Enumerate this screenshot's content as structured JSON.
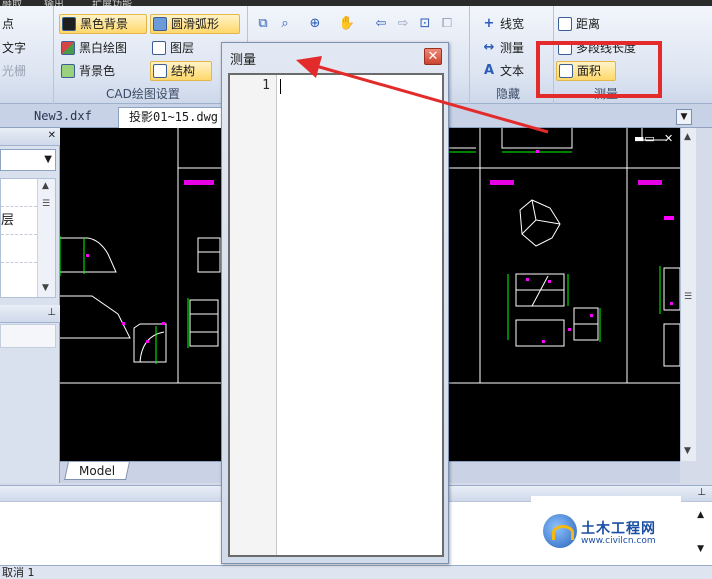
{
  "top_strip": {
    "tab_left": "融取",
    "tab_mid": "输出",
    "tab_right": "扩展功能"
  },
  "ribbon": {
    "left_fragments": [
      "点",
      "文字",
      "光栅"
    ],
    "cad_group": {
      "label": "CAD绘图设置",
      "black_bg": "黑色背景",
      "bw_draw": "黑白绘图",
      "bg_color": "背景色",
      "smooth_arc": "圆滑弧形",
      "layers": "图层",
      "structure": "结构"
    },
    "hide_group": {
      "label": "隐藏",
      "line_width": "线宽",
      "measure": "测量",
      "text": "文本"
    },
    "measure_group": {
      "label": "测量",
      "distance": "距离",
      "polyline_length": "多段线长度",
      "area": "面积"
    }
  },
  "doc_tabs": {
    "tab1": "New3.dxf",
    "tab2": "投影01~15.dwg"
  },
  "left_panel": {
    "layer_label": "层"
  },
  "cad": {
    "model_tab": "Model"
  },
  "dialog": {
    "title": "测量",
    "close": "✕",
    "line_number": "1"
  },
  "status": {
    "text": "取消 1"
  },
  "watermark": {
    "title": "土木工程网",
    "url": "www.civilcn.com"
  },
  "colors": {
    "highlight": "#e32b2b",
    "cad_bg": "#000000",
    "cad_lines": "#ffffff",
    "cad_dims": "#ff00ff",
    "cad_green": "#00ff00"
  }
}
